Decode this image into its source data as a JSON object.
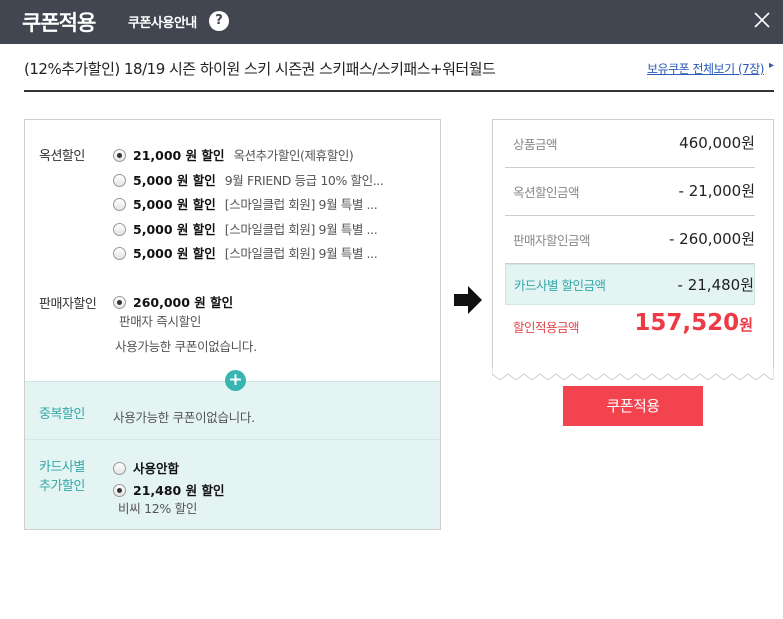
{
  "header": {
    "title": "쿠폰적용",
    "guide_label": "쿠폰사용안내",
    "help_symbol": "?"
  },
  "product": {
    "name": "(12%추가할인) 18/19 시즌 하이원 스키 시즌권 스키패스/스키패스+워터월드",
    "all_coupons_link": "보유쿠폰 전체보기 (7장)",
    "link_arrow": "▸"
  },
  "auction_discount": {
    "label": "옥션할인",
    "options": [
      {
        "amount": "21,000 원 할인",
        "desc": "옥션추가할인(제휴할인)",
        "selected": true
      },
      {
        "amount": "5,000 원 할인",
        "desc": "9월 FRIEND 등급 10% 할인...",
        "selected": false
      },
      {
        "amount": "5,000 원 할인",
        "desc": "[스마일클럽 회원] 9월 특별 ...",
        "selected": false
      },
      {
        "amount": "5,000 원 할인",
        "desc": "[스마일클럽 회원] 9월 특별 ...",
        "selected": false
      },
      {
        "amount": "5,000 원 할인",
        "desc": "[스마일클럽 회원] 9월 특별 ...",
        "selected": false
      }
    ]
  },
  "seller_discount": {
    "label": "판매자할인",
    "amount": "260,000 원 할인",
    "desc": "판매자 즉시할인",
    "note": "사용가능한 쿠폰이없습니다.",
    "selected": true
  },
  "duplicate_discount": {
    "label": "중복할인",
    "note": "사용가능한 쿠폰이없습니다."
  },
  "card_discount": {
    "label_line1": "카드사별",
    "label_line2": "추가할인",
    "options": [
      {
        "amount": "사용안함",
        "selected": false
      },
      {
        "amount": "21,480 원 할인",
        "selected": true
      }
    ],
    "desc": "비씨 12% 할인"
  },
  "summary": {
    "rows": [
      {
        "label": "상품금액",
        "value": "460,000원"
      },
      {
        "label": "옥션할인금액",
        "value": "- 21,000원"
      },
      {
        "label": "판매자할인금액",
        "value": "- 260,000원"
      },
      {
        "label": "카드사별 할인금액",
        "value": "- 21,480원"
      }
    ],
    "final_label": "할인적용금액",
    "final_value": "157,520",
    "final_unit": "원"
  },
  "apply_button": "쿠폰적용",
  "colors": {
    "header_bg": "#414650",
    "teal": "#35a7a8",
    "teal_bg": "#e3f4f3",
    "accent_red": "#f3434f",
    "link_blue": "#2a5bb8"
  }
}
